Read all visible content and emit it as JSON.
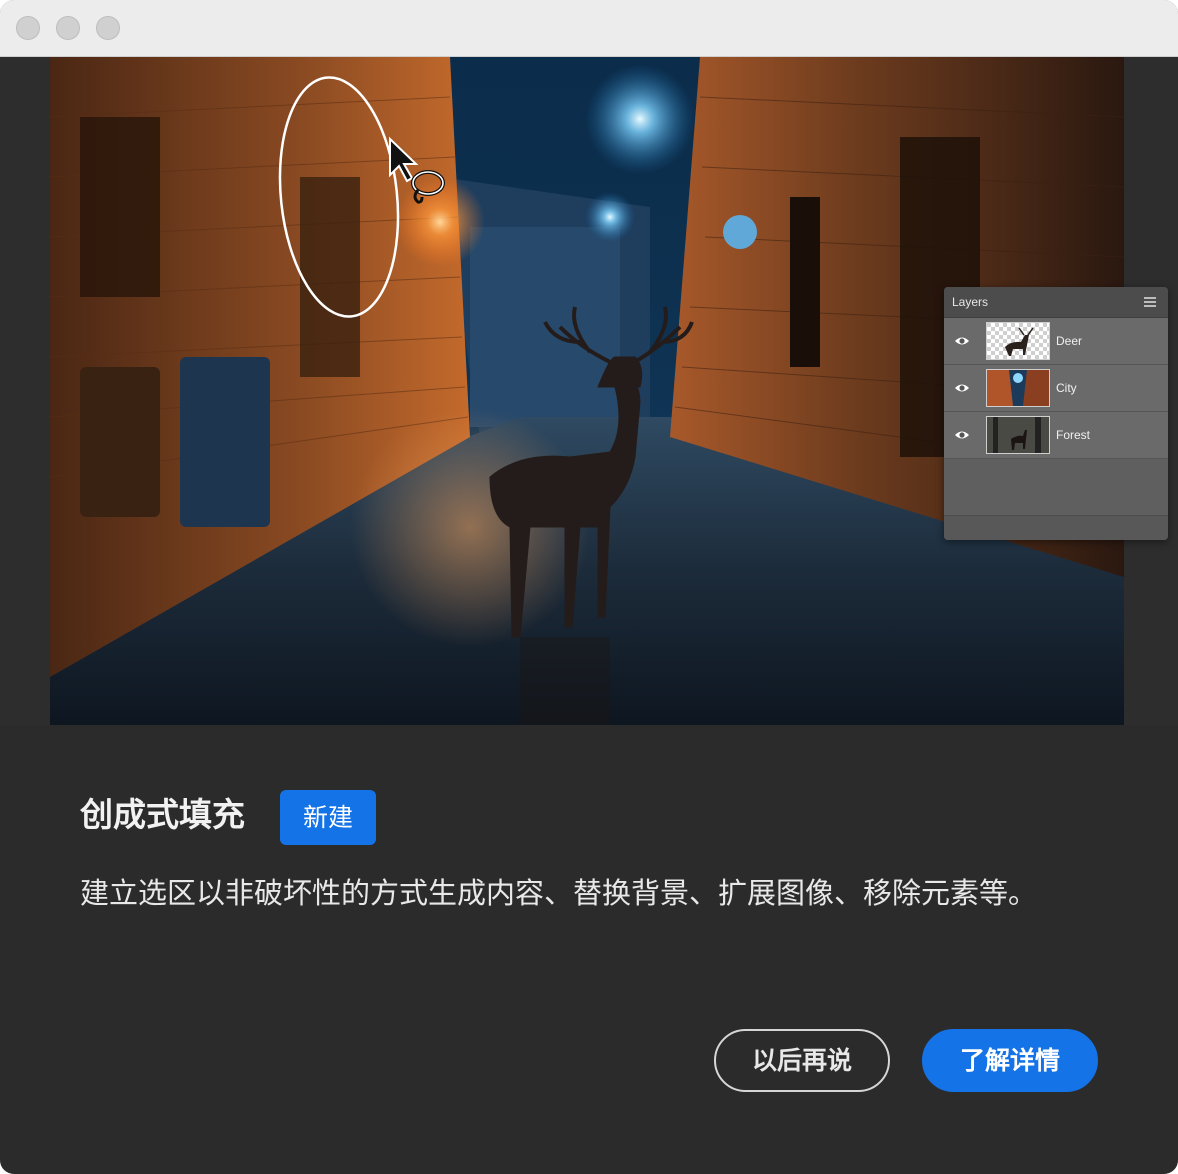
{
  "window": {
    "traffic_lights": [
      "close",
      "minimize",
      "zoom"
    ]
  },
  "photo": {
    "description_icon": "deer-in-alley-image",
    "selection_tool": "lasso-cursor-icon"
  },
  "layers_panel": {
    "title": "Layers",
    "menu_icon": "panel-menu-icon",
    "layers": [
      {
        "name": "Deer",
        "thumb": "deer"
      },
      {
        "name": "City",
        "thumb": "city"
      },
      {
        "name": "Forest",
        "thumb": "forest"
      }
    ]
  },
  "dialog": {
    "title": "创成式填充",
    "badge": "新建",
    "description": "建立选区以非破坏性的方式生成内容、替换背景、扩展图像、移除元素等。",
    "buttons": {
      "later": "以后再说",
      "learn_more": "了解详情"
    }
  },
  "colors": {
    "accent": "#1473e6",
    "panel_bg": "#2b2b2b"
  }
}
